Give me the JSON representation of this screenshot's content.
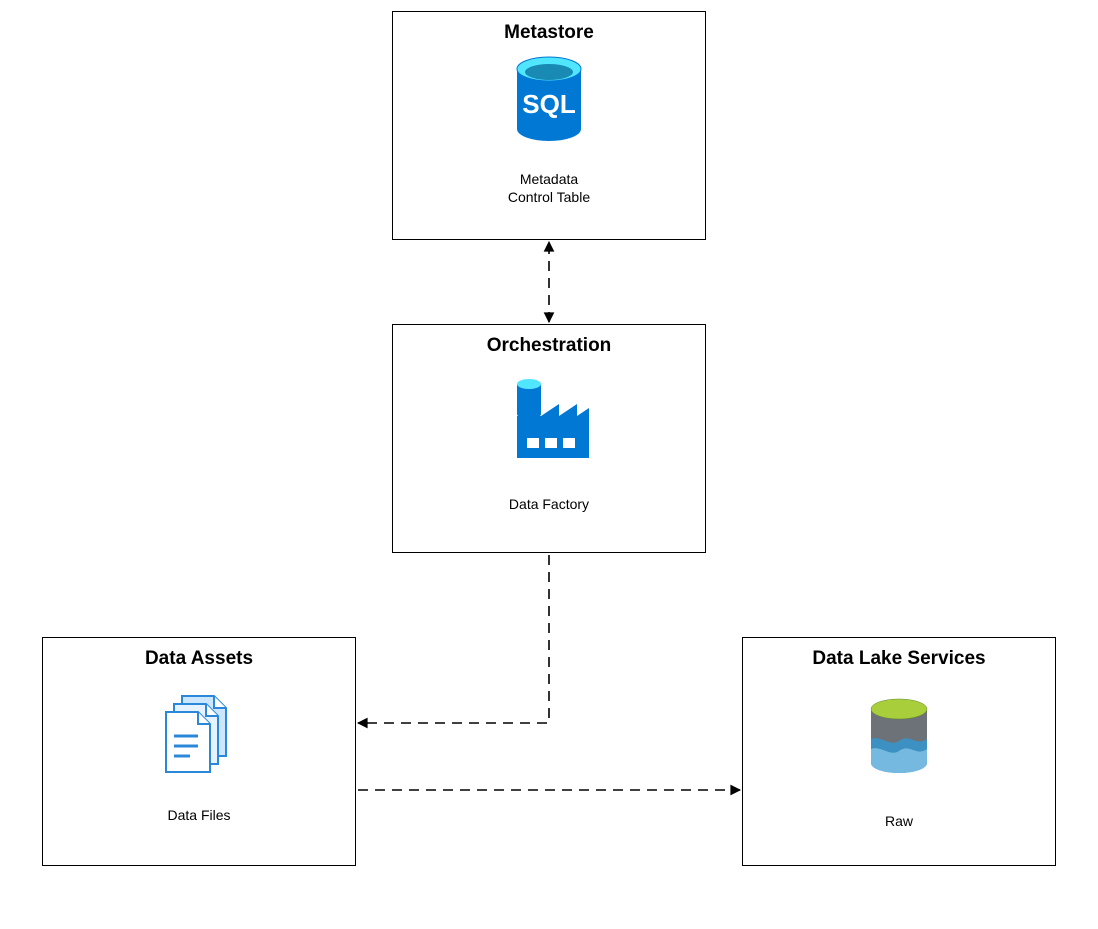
{
  "boxes": {
    "metastore": {
      "title": "Metastore",
      "sub1": "Metadata",
      "sub2": "Control Table"
    },
    "orchestration": {
      "title": "Orchestration",
      "sub1": "Data Factory"
    },
    "dataAssets": {
      "title": "Data Assets",
      "sub1": "Data Files"
    },
    "dataLake": {
      "title": "Data Lake Services",
      "sub1": "Raw"
    }
  },
  "icons": {
    "sqlLabel": "SQL"
  }
}
